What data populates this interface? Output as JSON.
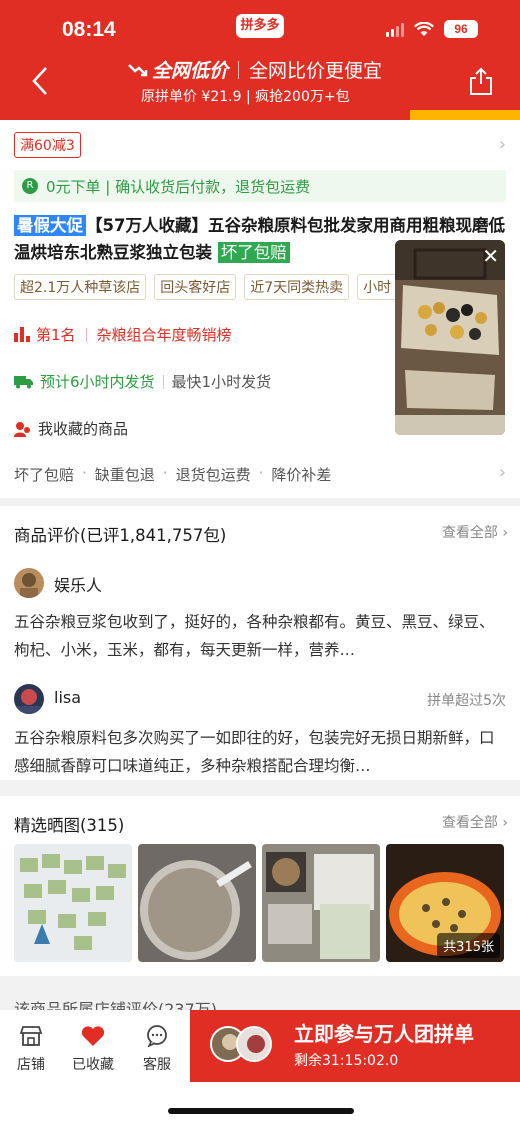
{
  "status": {
    "time": "08:14",
    "app_badge": "拼多多",
    "battery": "96"
  },
  "header": {
    "title": "全网低价",
    "subtitle": "全网比价更便宜",
    "price_info": "原拼单价 ¥21.9 | 疯抢200万+包"
  },
  "coupon": "满60减3",
  "guarantee": "0元下单 | 确认收货后付款，退货包运费",
  "product": {
    "promo_tag": "暑假大促",
    "title": "【57万人收藏】五谷杂粮原料包批发家用商用粗粮现磨低温烘培东北熟豆浆独立包装",
    "bad_tag": "坏了包赔",
    "chips": [
      "超2.1万人种草该店",
      "回头客好店",
      "近7天同类热卖",
      "小时"
    ]
  },
  "rank": {
    "label": "第1名",
    "desc": "杂粮组合年度畅销榜"
  },
  "shipping": {
    "estimate": "预计6小时内发货",
    "fastest": "最快1小时发货"
  },
  "favorites_label": "我收藏的商品",
  "services": [
    "坏了包赔",
    "缺重包退",
    "退货包运费",
    "降价补差"
  ],
  "reviews": {
    "title": "商品评价(已评1,841,757包)",
    "see_all": "查看全部",
    "items": [
      {
        "user": "娱乐人",
        "badge": "",
        "text": "五谷杂粮豆浆包收到了，挺好的，各种杂粮都有。黄豆、黑豆、绿豆、枸杞、小米，玉米，都有，每天更新一样，营养…"
      },
      {
        "user": "lisa",
        "badge": "拼单超过5次",
        "text": "五谷杂粮原料包多次购买了一如即往的好，包装完好无损日期新鲜，口感细腻香醇可口味道纯正，多种杂粮搭配合理均衡…"
      }
    ]
  },
  "photos": {
    "title": "精选晒图(315)",
    "see_all": "查看全部",
    "count_badge": "共315张"
  },
  "partial_text": "该商品所属店铺评价(237万)",
  "bottom": {
    "nav": [
      "店铺",
      "已收藏",
      "客服"
    ],
    "buy_label": "立即参与万人团拼单",
    "timer": "剩余31:15:02.0"
  },
  "colors": {
    "brand_red": "#e02e24",
    "green": "#2e9c43",
    "accent_yellow": "#ffb400"
  }
}
